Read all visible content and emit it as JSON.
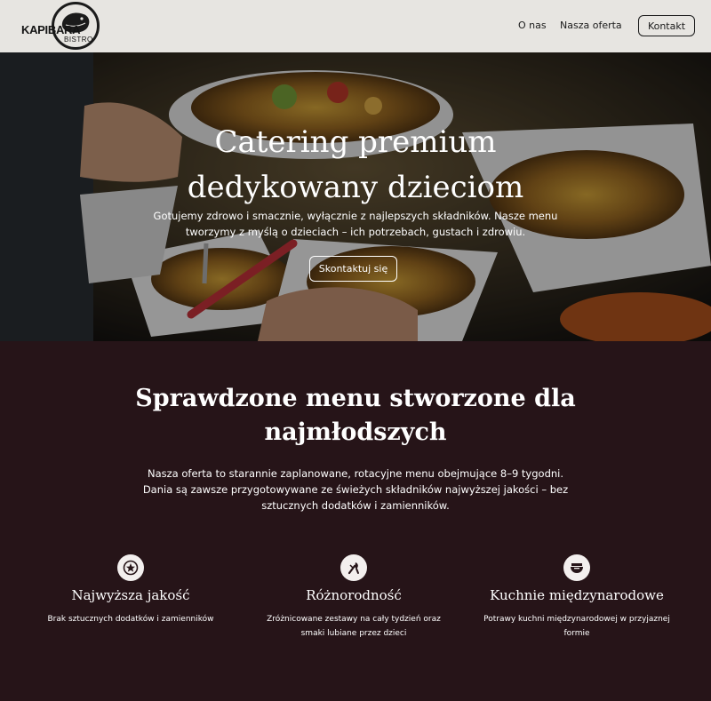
{
  "header": {
    "logo_text": "KAPIBARA",
    "logo_sub": "BISTRO",
    "nav": [
      {
        "label": "O nas"
      },
      {
        "label": "Nasza oferta"
      }
    ],
    "cta_label": "Kontakt"
  },
  "hero": {
    "title_line1": "Catering premium",
    "title_line2": "dedykowany dzieciom",
    "text": "Gotujemy zdrowo i smacznie, wyłącznie z najlepszych składników. Nasze menu tworzymy z myślą o dzieciach – ich potrzebach, gustach i zdrowiu.",
    "button_label": "Skontaktuj się"
  },
  "section": {
    "title": "Sprawdzone menu stworzone dla najmłodszych",
    "text": "Nasza oferta to starannie zaplanowane, rotacyjne menu obejmujące 8–9 tygodni. Dania są zawsze przygotowywane ze świeżych składników najwyższej jakości – bez sztucznych dodatków i zamienników.",
    "features": [
      {
        "icon": "star-badge-icon",
        "title": "Najwyższa jakość",
        "text": "Brak sztucznych dodatków i zamienników"
      },
      {
        "icon": "cutlery-icon",
        "title": "Różnorodność",
        "text": "Zróżnicowane zestawy na cały tydzień oraz smaki lubiane przez dzieci"
      },
      {
        "icon": "bowl-icon",
        "title": "Kuchnie międzynarodowe",
        "text": "Potrawy kuchni międzynarodowej w przyjaznej formie"
      }
    ]
  },
  "colors": {
    "header_bg": "#e7e5e1",
    "section_bg": "#261418",
    "text_light": "#ffffff",
    "text_dark": "#1a1a1a"
  }
}
